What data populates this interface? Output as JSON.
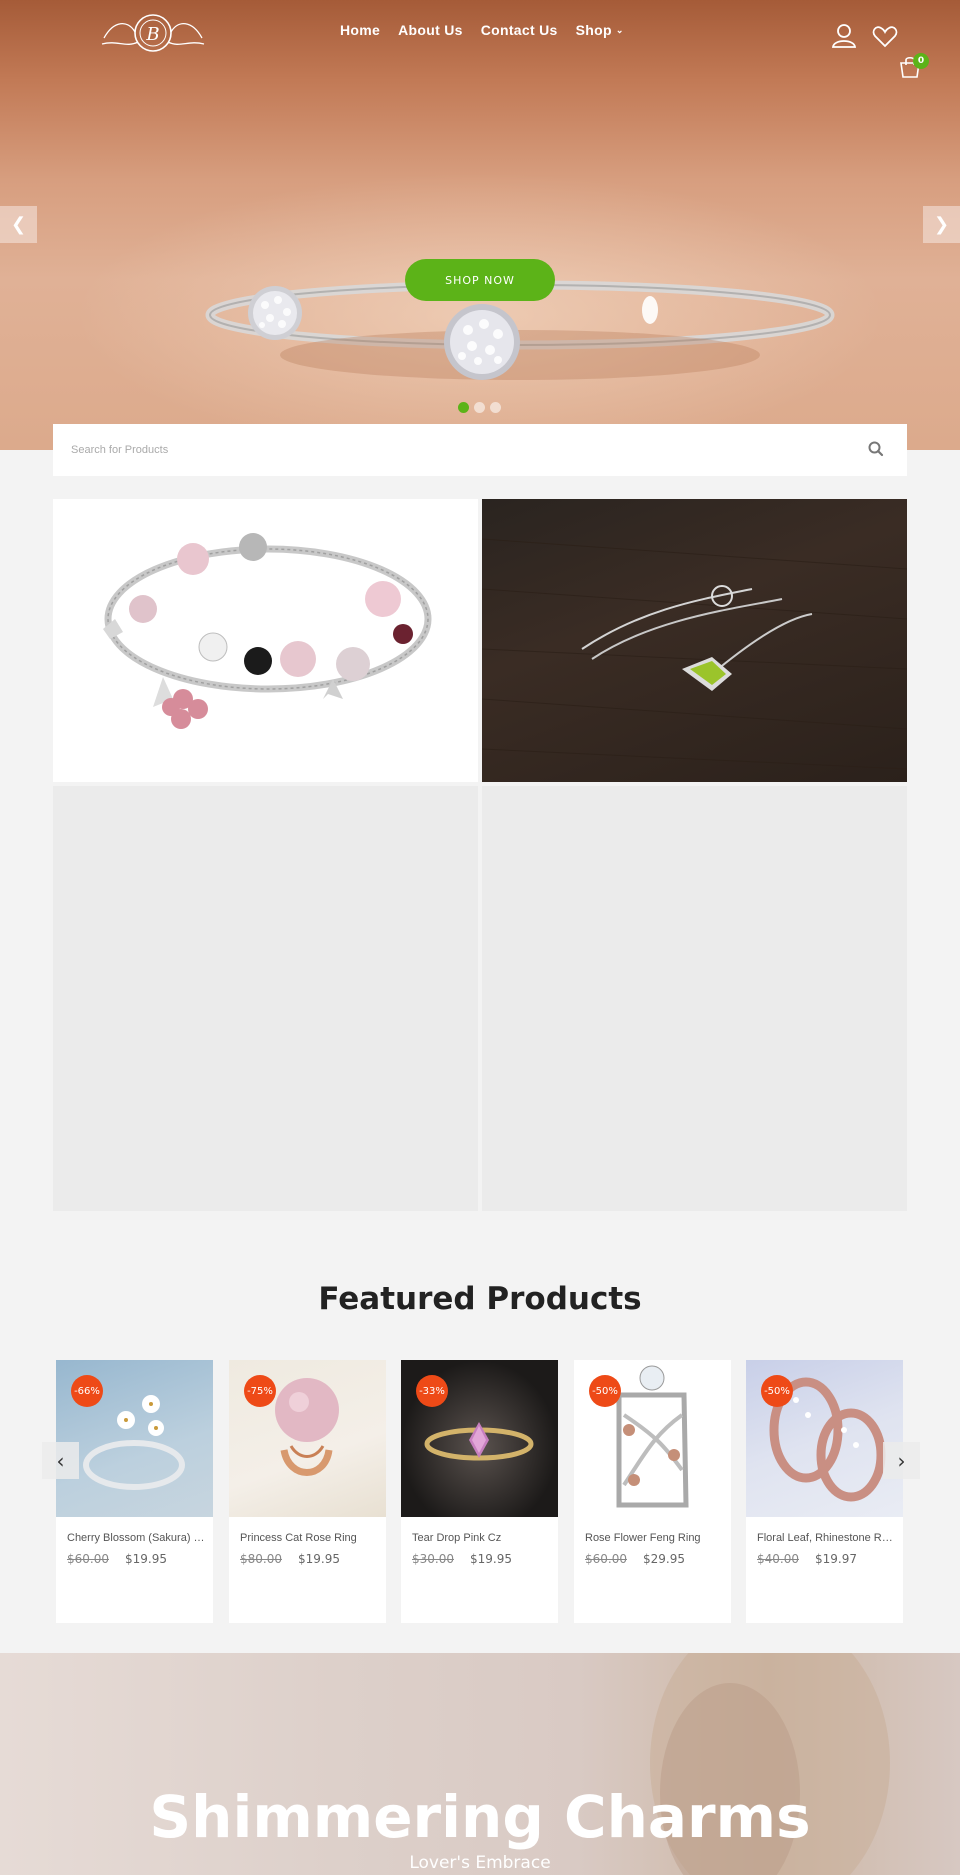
{
  "header": {
    "nav": [
      {
        "label": "Home"
      },
      {
        "label": "About Us"
      },
      {
        "label": "Contact Us"
      },
      {
        "label": "Shop"
      }
    ],
    "cart_count": "0",
    "icons": [
      "user-icon",
      "heart-icon",
      "cart-icon"
    ]
  },
  "hero": {
    "cta_label": "SHOP NOW",
    "slide_count": 3,
    "active_slide": 1
  },
  "search": {
    "placeholder": "Search for Products"
  },
  "featured": {
    "title": "Featured Products",
    "products": [
      {
        "name": "Cherry Blossom (Sakura) Ring",
        "old_price": "$60.00",
        "price": "$19.95",
        "discount": "-66%"
      },
      {
        "name": "Princess Cat Rose Ring",
        "old_price": "$80.00",
        "price": "$19.95",
        "discount": "-75%"
      },
      {
        "name": "Tear Drop Pink Cz",
        "old_price": "$30.00",
        "price": "$19.95",
        "discount": "-33%"
      },
      {
        "name": "Rose Flower Feng Ring",
        "old_price": "$60.00",
        "price": "$29.95",
        "discount": "-50%"
      },
      {
        "name": "Floral Leaf, Rhinestone Rings",
        "old_price": "$40.00",
        "price": "$19.97",
        "discount": "-50%"
      }
    ]
  },
  "promo": {
    "title": "Shimmering Charms",
    "subtitle": "Lover's Embrace"
  },
  "colors": {
    "accent": "#5cb318",
    "badge": "#ee4a17"
  }
}
